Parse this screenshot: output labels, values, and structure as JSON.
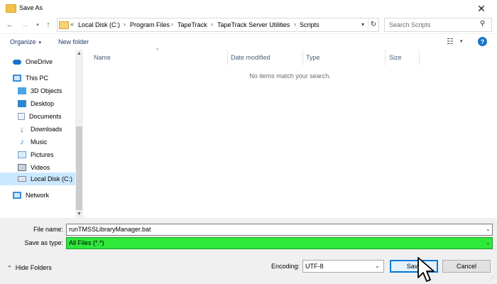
{
  "window": {
    "title": "Save As",
    "close_icon": "close-icon"
  },
  "address": {
    "prefix": "«",
    "crumbs": [
      "Local Disk (C:)",
      "Program Files",
      "TapeTrack",
      "TapeTrack Server Utilities",
      "Scripts"
    ]
  },
  "search": {
    "placeholder": "Search Scripts"
  },
  "toolbar": {
    "organize_label": "Organize",
    "new_folder_label": "New folder"
  },
  "nav_pane": {
    "items": [
      {
        "label": "OneDrive",
        "icon": "cloud-icon",
        "color": "#1a73c9"
      },
      {
        "label": "This PC",
        "icon": "computer-icon",
        "color": "#3a8fd6"
      },
      {
        "label": "3D Objects",
        "icon": "cube-icon",
        "color": "#4aa5e8"
      },
      {
        "label": "Desktop",
        "icon": "desktop-icon",
        "color": "#2f86d0"
      },
      {
        "label": "Documents",
        "icon": "document-icon",
        "color": "#8a9aad"
      },
      {
        "label": "Downloads",
        "icon": "download-icon",
        "color": "#1a73c9"
      },
      {
        "label": "Music",
        "icon": "music-icon",
        "color": "#2f86d0"
      },
      {
        "label": "Pictures",
        "icon": "pictures-icon",
        "color": "#6aa6d8"
      },
      {
        "label": "Videos",
        "icon": "video-icon",
        "color": "#5a6b80"
      },
      {
        "label": "Local Disk (C:)",
        "icon": "drive-icon",
        "color": "#7a8aa0"
      },
      {
        "label": "Network",
        "icon": "network-icon",
        "color": "#3a8fd6"
      }
    ]
  },
  "file_list": {
    "columns": [
      "Name",
      "Date modified",
      "Type",
      "Size"
    ],
    "empty_message": "No items match your search."
  },
  "form": {
    "file_name_label": "File name:",
    "file_name_value": "runTMSSLibraryManager.bat",
    "save_type_label": "Save as type:",
    "save_type_value": "All Files  (*.*)",
    "encoding_label": "Encoding:",
    "encoding_value": "UTF-8",
    "save_label": "Save",
    "cancel_label": "Cancel",
    "hide_folders_label": "Hide Folders"
  },
  "colors": {
    "accent": "#0078d7",
    "highlight_green": "#2ee83a",
    "selection": "#cce8ff"
  }
}
